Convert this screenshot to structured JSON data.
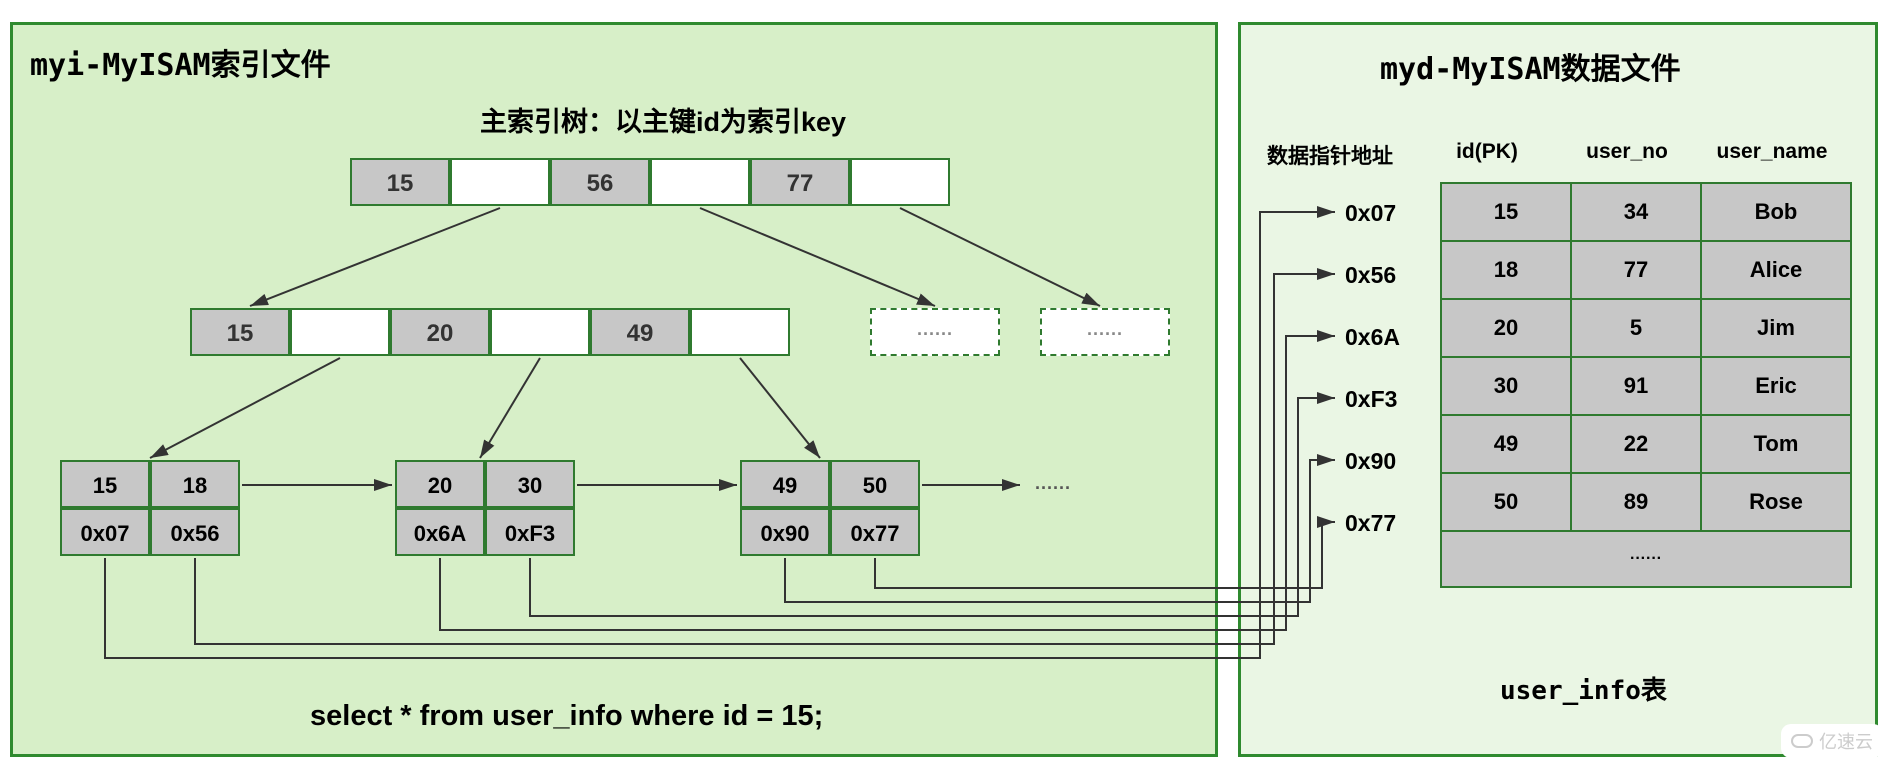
{
  "left_panel": {
    "title": "myi-MyISAM索引文件",
    "subtitle": "主索引树：以主键id为索引key",
    "sql": "select  * from user_info  where id = 15;",
    "root": [
      "15",
      "",
      "56",
      "",
      "77",
      ""
    ],
    "mid_left": [
      "15",
      "",
      "20",
      "",
      "49",
      ""
    ],
    "mid_dash1": "······",
    "mid_dash2": "······",
    "leaf1_top": [
      "15",
      "18"
    ],
    "leaf1_bot": [
      "0x07",
      "0x56"
    ],
    "leaf2_top": [
      "20",
      "30"
    ],
    "leaf2_bot": [
      "0x6A",
      "0xF3"
    ],
    "leaf3_top": [
      "49",
      "50"
    ],
    "leaf3_bot": [
      "0x90",
      "0x77"
    ],
    "leaf_ellipsis": "······"
  },
  "right_panel": {
    "title": "myd-MyISAM数据文件",
    "headers": [
      "数据指针地址",
      "id(PK)",
      "user_no",
      "user_name"
    ],
    "addr": [
      "0x07",
      "0x56",
      "0x6A",
      "0xF3",
      "0x90",
      "0x77"
    ],
    "rows": [
      [
        "15",
        "34",
        "Bob"
      ],
      [
        "18",
        "77",
        "Alice"
      ],
      [
        "20",
        "5",
        "Jim"
      ],
      [
        "30",
        "91",
        "Eric"
      ],
      [
        "49",
        "22",
        "Tom"
      ],
      [
        "50",
        "89",
        "Rose"
      ]
    ],
    "ellipsis": "······",
    "table_name": "user_info表"
  },
  "watermark": "亿速云"
}
